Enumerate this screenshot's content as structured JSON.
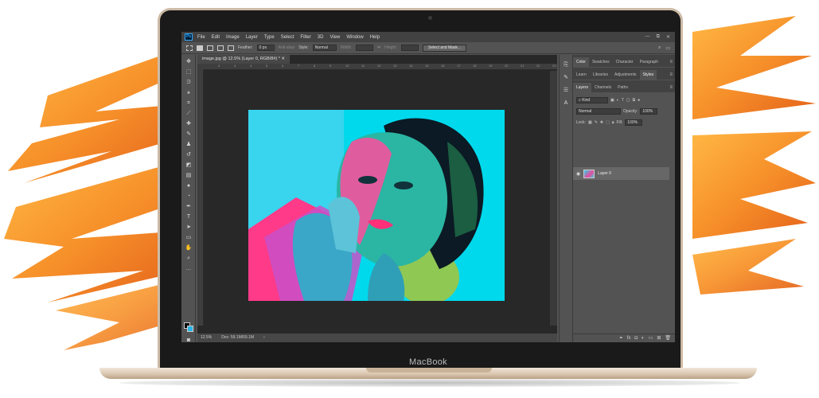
{
  "device": {
    "brand": "MacBook"
  },
  "menubar": {
    "logo": "Ps",
    "items": [
      "File",
      "Edit",
      "Image",
      "Layer",
      "Type",
      "Select",
      "Filter",
      "3D",
      "View",
      "Window",
      "Help"
    ],
    "window_controls": [
      "—",
      "⧉",
      "✕"
    ]
  },
  "options": {
    "feather_label": "Feather:",
    "feather_value": "0 px",
    "antialias_label": "Anti-alias",
    "style_label": "Style:",
    "style_value": "Normal",
    "width_label": "Width:",
    "height_label": "Height:",
    "select_mask_label": "Select and Mask..."
  },
  "document": {
    "tab_title": "image.jpg @ 12.5% (Layer 0, RGB/8#) * ✕",
    "ruler_ticks": [
      "2",
      "3",
      "4",
      "5",
      "6",
      "7",
      "8",
      "9",
      "10",
      "11",
      "12",
      "13",
      "14",
      "15",
      "16",
      "17",
      "18",
      "19",
      "20",
      "21",
      "22",
      "23"
    ],
    "zoom": "12.5%",
    "doc_size": "Doc: 59.1M/59.1M"
  },
  "panels": {
    "group1_tabs": [
      "Color",
      "Swatches",
      "Character",
      "Paragraph"
    ],
    "group2_tabs": [
      "Learn",
      "Libraries",
      "Adjustments",
      "Styles"
    ],
    "group3_tabs": [
      "Layers",
      "Channels",
      "Paths"
    ],
    "kind_label": "Kind",
    "blend_mode": "Normal",
    "opacity_label": "Opacity:",
    "opacity_value": "100%",
    "lock_label": "Lock:",
    "fill_label": "Fill:",
    "fill_value": "100%",
    "layer_name": "Layer 0"
  },
  "colors": {
    "foreground": "#000000",
    "background": "#29b5e8",
    "brush_orange": "#f68b1f"
  }
}
